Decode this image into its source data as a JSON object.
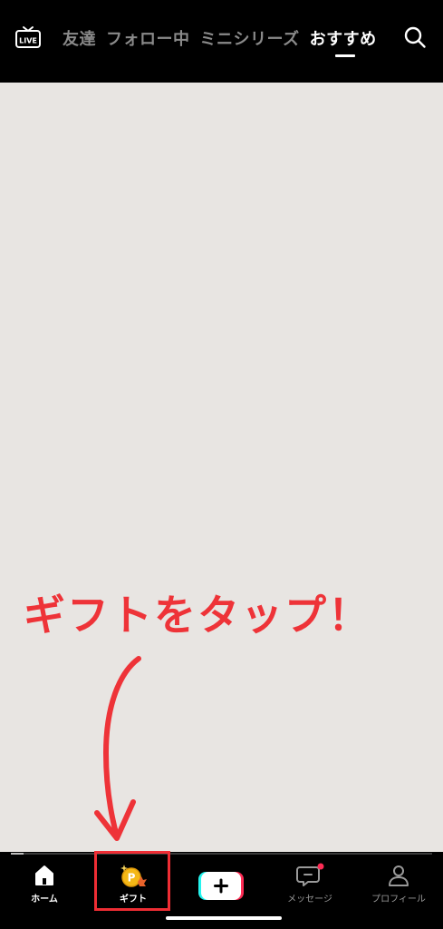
{
  "topbar": {
    "live_label": "LIVE",
    "tabs": [
      {
        "label": "友達"
      },
      {
        "label": "フォロー中"
      },
      {
        "label": "ミニシリーズ"
      },
      {
        "label": "おすすめ"
      }
    ],
    "active_tab": "おすすめ"
  },
  "annotation": {
    "text": "ギフトをタップ！",
    "color": "#ee3338"
  },
  "video": {
    "progress": 0.03
  },
  "bottomnav": {
    "items": [
      {
        "label": "ホーム",
        "icon": "home-icon"
      },
      {
        "label": "ギフト",
        "icon": "gift-coin-icon"
      },
      {
        "label": "",
        "icon": "create-plus-icon"
      },
      {
        "label": "メッセージ",
        "icon": "message-icon"
      },
      {
        "label": "プロフィール",
        "icon": "profile-icon"
      }
    ],
    "notification_color": "#fe2c55",
    "highlight_color": "#ee2d34"
  }
}
